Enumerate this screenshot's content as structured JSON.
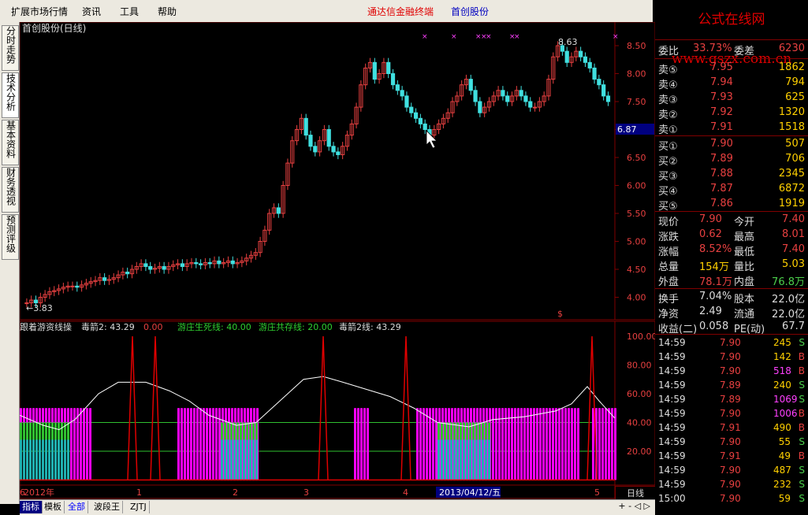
{
  "menu": {
    "items": [
      "扩展市场行情",
      "资讯",
      "工具",
      "帮助"
    ],
    "app_title": "通达信金融终端",
    "stock_title": "首创股份"
  },
  "left_tabs": [
    "分时走势",
    "技术分析",
    "基本资料",
    "财务透视",
    "预测评级"
  ],
  "chart": {
    "caption": "首创股份(日线)",
    "high_label": "8.63",
    "low_label": "3.83",
    "current_price_tag": "6.87",
    "price_axis": [
      "8.50",
      "8.00",
      "7.50",
      "7.00",
      "6.50",
      "6.00",
      "5.50",
      "5.00",
      "4.50",
      "4.00"
    ],
    "indicator_axis": [
      "100.00",
      "80.00",
      "60.00",
      "40.00",
      "20.00"
    ],
    "indicator_header": {
      "name": "跟着游资线操",
      "a": "毒箭2: 43.29",
      "b": "0.00",
      "c": "游庄生死线: 40.00",
      "d": "游庄共存线: 20.00",
      "e": "毒箭2线: 43.29"
    },
    "time_axis": [
      "2012年",
      "1",
      "2",
      "3",
      "4",
      "2013/04/12/五",
      "5",
      "6"
    ],
    "dollar_mark": "$",
    "period_button": "日线"
  },
  "bottom_tabs": [
    "指标",
    "模板",
    "全部",
    "波段王",
    "ZJTJ"
  ],
  "quote": {
    "logo": "公式在线网www.gszx.com.cn",
    "weibi_label": "委比",
    "weibi": "33.73%",
    "weicha_label": "委差",
    "weicha": "6230",
    "sells": [
      {
        "label": "卖⑤",
        "price": "7.95",
        "vol": "1862"
      },
      {
        "label": "卖④",
        "price": "7.94",
        "vol": "794"
      },
      {
        "label": "卖③",
        "price": "7.93",
        "vol": "625"
      },
      {
        "label": "卖②",
        "price": "7.92",
        "vol": "1320"
      },
      {
        "label": "卖①",
        "price": "7.91",
        "vol": "1518"
      }
    ],
    "buys": [
      {
        "label": "买①",
        "price": "7.90",
        "vol": "507"
      },
      {
        "label": "买②",
        "price": "7.89",
        "vol": "706"
      },
      {
        "label": "买③",
        "price": "7.88",
        "vol": "2345"
      },
      {
        "label": "买④",
        "price": "7.87",
        "vol": "6872"
      },
      {
        "label": "买⑤",
        "price": "7.86",
        "vol": "1919"
      }
    ],
    "stats": [
      {
        "l1": "现价",
        "v1": "7.90",
        "l2": "今开",
        "v2": "7.40"
      },
      {
        "l1": "涨跌",
        "v1": "0.62",
        "l2": "最高",
        "v2": "8.01"
      },
      {
        "l1": "涨幅",
        "v1": "8.52%",
        "l2": "最低",
        "v2": "7.40"
      },
      {
        "l1": "总量",
        "v1": "154万",
        "l2": "量比",
        "v2": "5.03"
      },
      {
        "l1": "外盘",
        "v1": "78.1万",
        "l2": "内盘",
        "v2": "76.8万"
      }
    ],
    "stats2": [
      {
        "l1": "换手",
        "v1": "7.04%",
        "l2": "股本",
        "v2": "22.0亿"
      },
      {
        "l1": "净资",
        "v1": "2.49",
        "l2": "流通",
        "v2": "22.0亿"
      },
      {
        "l1": "收益(二)",
        "v1": "0.058",
        "l2": "PE(动)",
        "v2": "67.7"
      }
    ],
    "ticks": [
      {
        "t": "14:59",
        "p": "7.90",
        "v": "245",
        "s": "S"
      },
      {
        "t": "14:59",
        "p": "7.90",
        "v": "142",
        "s": "B"
      },
      {
        "t": "14:59",
        "p": "7.90",
        "v": "518",
        "s": "B"
      },
      {
        "t": "14:59",
        "p": "7.89",
        "v": "240",
        "s": "S"
      },
      {
        "t": "14:59",
        "p": "7.89",
        "v": "1069",
        "s": "S"
      },
      {
        "t": "14:59",
        "p": "7.90",
        "v": "1006",
        "s": "B"
      },
      {
        "t": "14:59",
        "p": "7.91",
        "v": "490",
        "s": "B"
      },
      {
        "t": "14:59",
        "p": "7.90",
        "v": "55",
        "s": "S"
      },
      {
        "t": "14:59",
        "p": "7.91",
        "v": "49",
        "s": "B"
      },
      {
        "t": "14:59",
        "p": "7.90",
        "v": "487",
        "s": "S"
      },
      {
        "t": "14:59",
        "p": "7.90",
        "v": "232",
        "s": "S"
      },
      {
        "t": "15:00",
        "p": "7.90",
        "v": "59",
        "s": "S"
      }
    ]
  },
  "colors": {
    "up": "#e84040",
    "down": "#40e0e0",
    "magenta": "#ff00ff",
    "green": "#30c030",
    "teal": "#20b0b0"
  }
}
